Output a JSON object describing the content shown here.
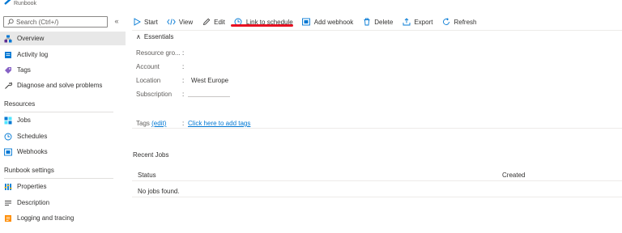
{
  "header": {
    "subtitle": "Runbook"
  },
  "sidebar": {
    "search_placeholder": "Search (Ctrl+/)",
    "collapse_icon": "«",
    "items": [
      {
        "label": "Overview",
        "icon": "overview-icon",
        "active": true
      },
      {
        "label": "Activity log",
        "icon": "activity-log-icon"
      },
      {
        "label": "Tags",
        "icon": "tag-icon"
      },
      {
        "label": "Diagnose and solve problems",
        "icon": "wrench-icon"
      }
    ],
    "sections": [
      {
        "title": "Resources",
        "items": [
          {
            "label": "Jobs",
            "icon": "jobs-icon"
          },
          {
            "label": "Schedules",
            "icon": "clock-icon"
          },
          {
            "label": "Webhooks",
            "icon": "webhook-icon"
          }
        ]
      },
      {
        "title": "Runbook settings",
        "items": [
          {
            "label": "Properties",
            "icon": "properties-icon"
          },
          {
            "label": "Description",
            "icon": "description-icon"
          },
          {
            "label": "Logging and tracing",
            "icon": "logging-icon"
          }
        ]
      }
    ]
  },
  "toolbar": {
    "start": "Start",
    "view": "View",
    "edit": "Edit",
    "link_to_schedule": "Link to schedule",
    "add_webhook": "Add webhook",
    "delete": "Delete",
    "export": "Export",
    "refresh": "Refresh"
  },
  "essentials": {
    "toggle_label": "Essentials",
    "rows": [
      {
        "label": "Resource gro...",
        "value": ""
      },
      {
        "label": "Account",
        "value": ""
      },
      {
        "label": "Location",
        "value": "West Europe"
      },
      {
        "label": "Subscription",
        "value": ""
      }
    ],
    "tags_label": "Tags",
    "tags_edit": "(edit)",
    "tags_link": "Click here to add tags"
  },
  "recent_jobs": {
    "title": "Recent Jobs",
    "columns": [
      "Status",
      "Created"
    ],
    "empty_text": "No jobs found."
  },
  "colors": {
    "accent": "#0078d4",
    "highlight_mark": "#e81123"
  }
}
